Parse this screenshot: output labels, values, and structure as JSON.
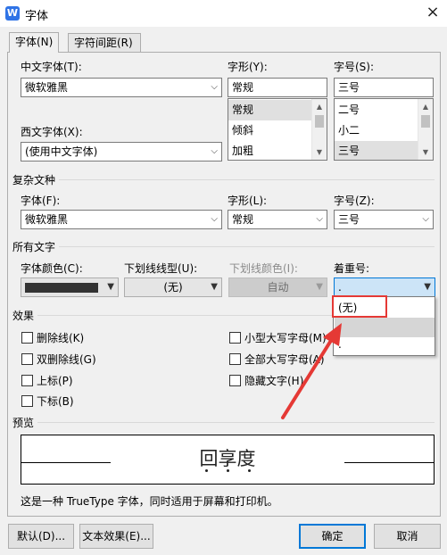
{
  "window": {
    "title": "字体",
    "app_icon_glyph": "W",
    "close_glyph": "×"
  },
  "tabs": [
    {
      "label": "字体(N)"
    },
    {
      "label": "字符间距(R)"
    }
  ],
  "chinese_font": {
    "label": "中文字体(T):",
    "value": "微软雅黑"
  },
  "style": {
    "label": "字形(Y):",
    "value": "常规",
    "options": [
      "常规",
      "倾斜",
      "加粗"
    ]
  },
  "size": {
    "label": "字号(S):",
    "value": "三号",
    "options": [
      "二号",
      "小二",
      "三号"
    ]
  },
  "western_font": {
    "label": "西文字体(X):",
    "value": "(使用中文字体)"
  },
  "complex": {
    "section": "复杂文种",
    "font_label": "字体(F):",
    "font_value": "微软雅黑",
    "style_label": "字形(L):",
    "style_value": "常规",
    "size_label": "字号(Z):",
    "size_value": "三号"
  },
  "all_text": {
    "section": "所有文字",
    "color_label": "字体颜色(C):",
    "underline_label": "下划线线型(U):",
    "underline_value": "(无)",
    "underline_color_label": "下划线颜色(I):",
    "underline_color_value": "自动",
    "emphasis_label": "着重号:",
    "emphasis_value": "."
  },
  "emphasis_dropdown": {
    "options": [
      "(无)",
      "",
      "."
    ]
  },
  "effects": {
    "section": "效果",
    "left": [
      "删除线(K)",
      "双删除线(G)",
      "上标(P)",
      "下标(B)"
    ],
    "right": [
      "小型大写字母(M)",
      "全部大写字母(A)",
      "隐藏文字(H)"
    ]
  },
  "preview": {
    "section": "预览",
    "sample": "回享度"
  },
  "note": "这是一种 TrueType 字体，同时适用于屏幕和打印机。",
  "buttons": {
    "default": "默认(D)...",
    "text_effects": "文本效果(E)...",
    "ok": "确定",
    "cancel": "取消"
  },
  "colors": {
    "font_color": "#333333",
    "annotation_red": "#e53935",
    "accent": "#2f73e6"
  }
}
